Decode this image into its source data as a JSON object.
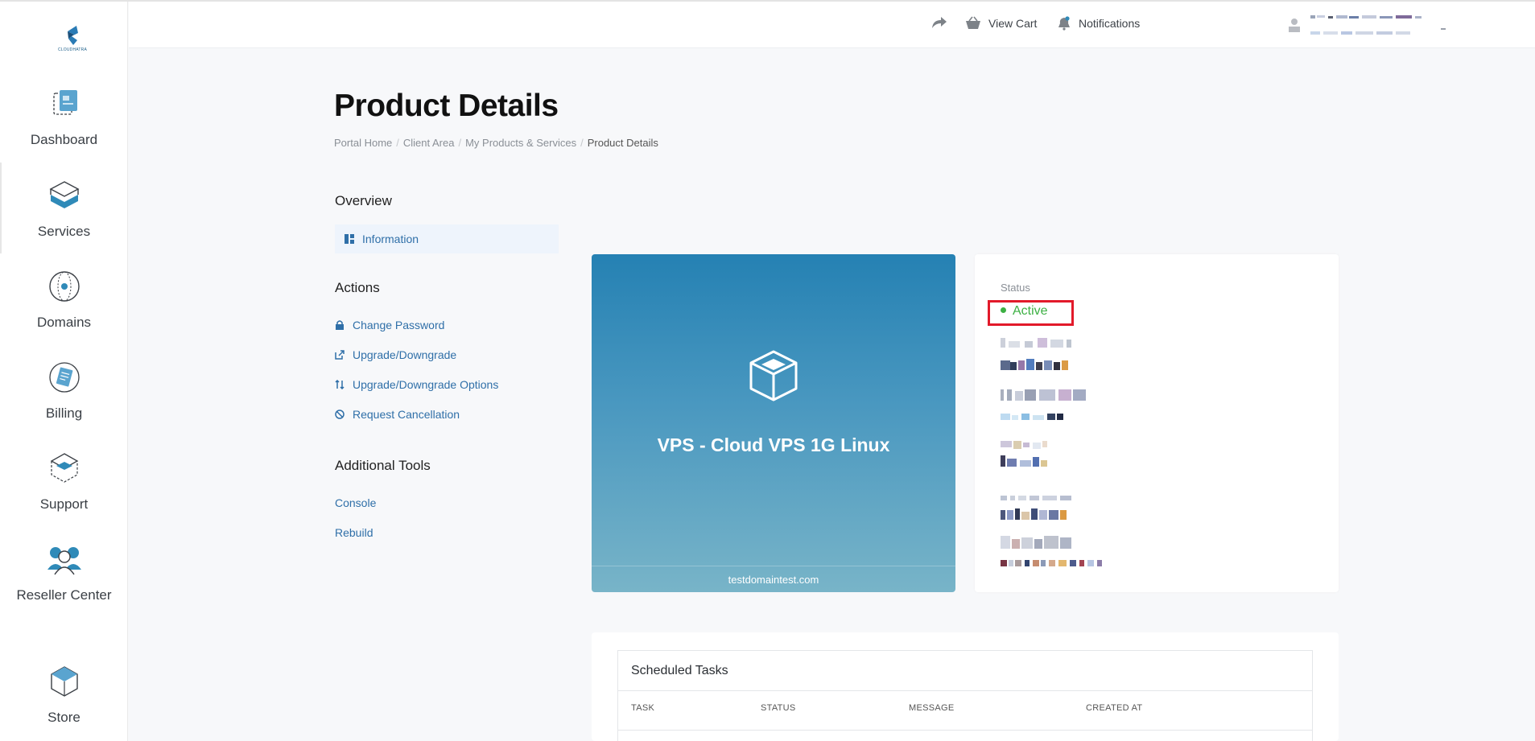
{
  "header": {
    "view_cart": "View Cart",
    "notifications": "Notifications"
  },
  "sidebar": {
    "logo_text": "CLOUDHATRA",
    "items": [
      {
        "label": "Dashboard"
      },
      {
        "label": "Services"
      },
      {
        "label": "Domains"
      },
      {
        "label": "Billing"
      },
      {
        "label": "Support"
      },
      {
        "label": "Reseller Center"
      },
      {
        "label": "Store"
      }
    ]
  },
  "page": {
    "title": "Product Details",
    "breadcrumb": [
      "Portal Home",
      "Client Area",
      "My Products & Services",
      "Product Details"
    ]
  },
  "side_menu": {
    "overview_heading": "Overview",
    "information": "Information",
    "actions_heading": "Actions",
    "actions": [
      "Change Password",
      "Upgrade/Downgrade",
      "Upgrade/Downgrade Options",
      "Request Cancellation"
    ],
    "tools_heading": "Additional Tools",
    "tools": [
      "Console",
      "Rebuild"
    ]
  },
  "product": {
    "name": "VPS - Cloud VPS 1G Linux",
    "domain": "testdomaintest.com"
  },
  "status": {
    "label": "Status",
    "value": "Active",
    "value_color": "#3cb043",
    "highlight_color": "#e21a2a"
  },
  "tasks": {
    "title": "Scheduled Tasks",
    "columns": [
      "TASK",
      "STATUS",
      "MESSAGE",
      "CREATED AT"
    ]
  }
}
